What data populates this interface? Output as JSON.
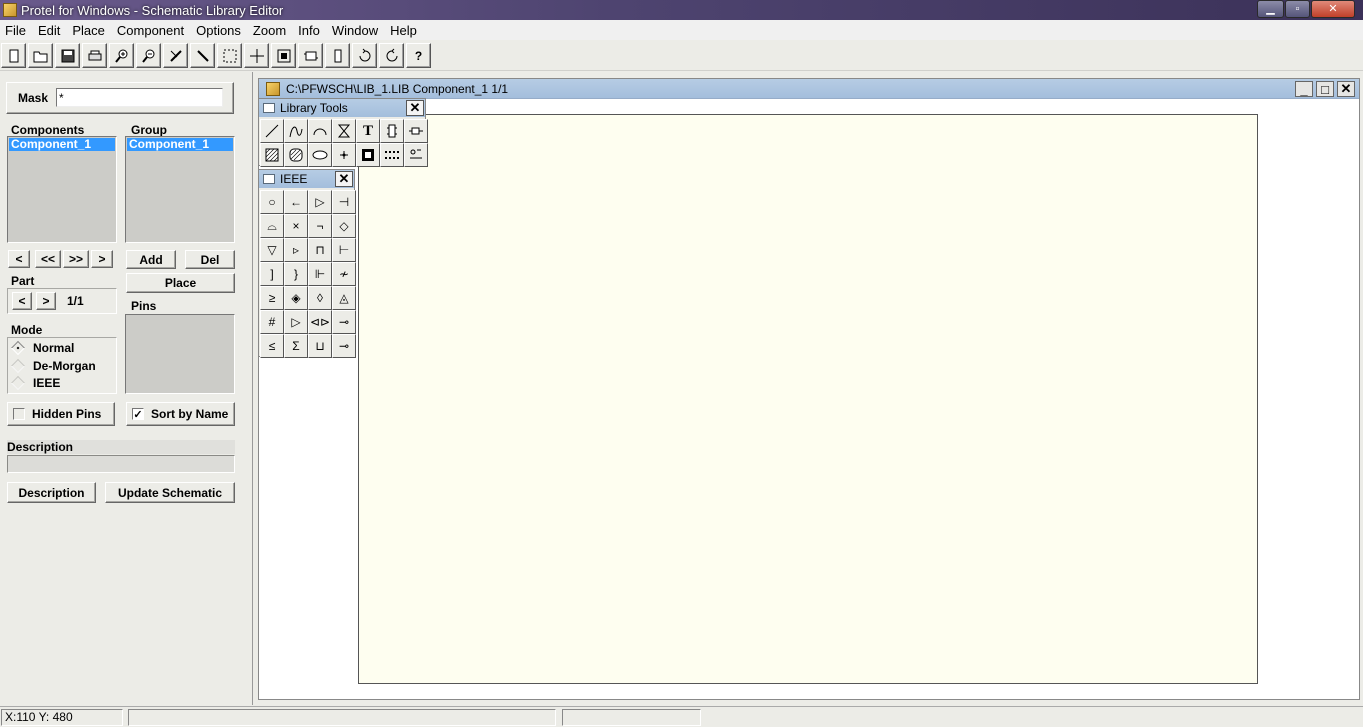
{
  "app": {
    "title": "Protel for Windows - Schematic Library Editor",
    "window_controls": [
      "minimize",
      "maximize",
      "close"
    ]
  },
  "menu": [
    "File",
    "Edit",
    "Place",
    "Component",
    "Options",
    "Zoom",
    "Info",
    "Window",
    "Help"
  ],
  "toolbar": {
    "buttons": [
      "new-sheet-icon",
      "open-folder-icon",
      "save-icon",
      "print-icon",
      "zoom-in-icon",
      "zoom-out-icon",
      "cut-icon",
      "wire-icon",
      "select-area-icon",
      "move-icon",
      "fit-icon",
      "place-part-icon",
      "component-icon",
      "pin-icon",
      "rotate-icon",
      "mirror-icon",
      "help-icon"
    ],
    "help_label": "?"
  },
  "left_panel": {
    "mask_label": "Mask",
    "mask_value": "*",
    "components_label": "Components",
    "components_items": [
      "Component_1"
    ],
    "group_label": "Group",
    "group_items": [
      "Component_1"
    ],
    "nav_buttons": [
      "<",
      "<<",
      ">>",
      ">"
    ],
    "add_label": "Add",
    "del_label": "Del",
    "place_label": "Place",
    "part_label": "Part",
    "part_prev": "<",
    "part_next": ">",
    "part_value": "1/1",
    "pins_label": "Pins",
    "mode_label": "Mode",
    "modes": [
      {
        "label": "Normal",
        "selected": true
      },
      {
        "label": "De-Morgan",
        "selected": false
      },
      {
        "label": "IEEE",
        "selected": false
      }
    ],
    "hidden_pins_label": "Hidden Pins",
    "hidden_pins_checked": false,
    "sort_by_name_label": "Sort by Name",
    "sort_by_name_checked": true,
    "check_mark": "✓",
    "description_label": "Description",
    "description_button": "Description",
    "update_schematic_button": "Update Schematic"
  },
  "document": {
    "title": "C:\\PFWSCH\\LIB_1.LIB  Component_1 1/1",
    "controls": [
      "_",
      "□",
      "✕"
    ],
    "sheet_color": "#fefef0"
  },
  "library_tools": {
    "title": "Library Tools",
    "close": "✕",
    "tools": [
      "line-icon",
      "bezier-icon",
      "arc-icon",
      "polygon-icon",
      "text-icon",
      "new-component-icon",
      "add-part-icon",
      "rectangle-icon",
      "rounded-rectangle-icon",
      "ellipse-icon",
      "pie-icon",
      "image-icon",
      "array-icon",
      "pin-icon"
    ],
    "text_label": "T"
  },
  "ieee_palette": {
    "title": "IEEE",
    "close": "✕",
    "symbols": [
      "○",
      "←",
      "▷",
      "⊣",
      "⌓",
      "×",
      "¬",
      "◇",
      "▽",
      "▹",
      "⊓",
      "⊢",
      "]",
      "}",
      "⊩",
      "≁",
      "≥",
      "◈",
      "◊",
      "◬",
      "#",
      "▷",
      "⊲⊳",
      "⊸",
      "≤",
      "Σ",
      "⊔",
      "⊸"
    ]
  },
  "status_bar": {
    "coordinates": "X:110 Y: 480"
  }
}
